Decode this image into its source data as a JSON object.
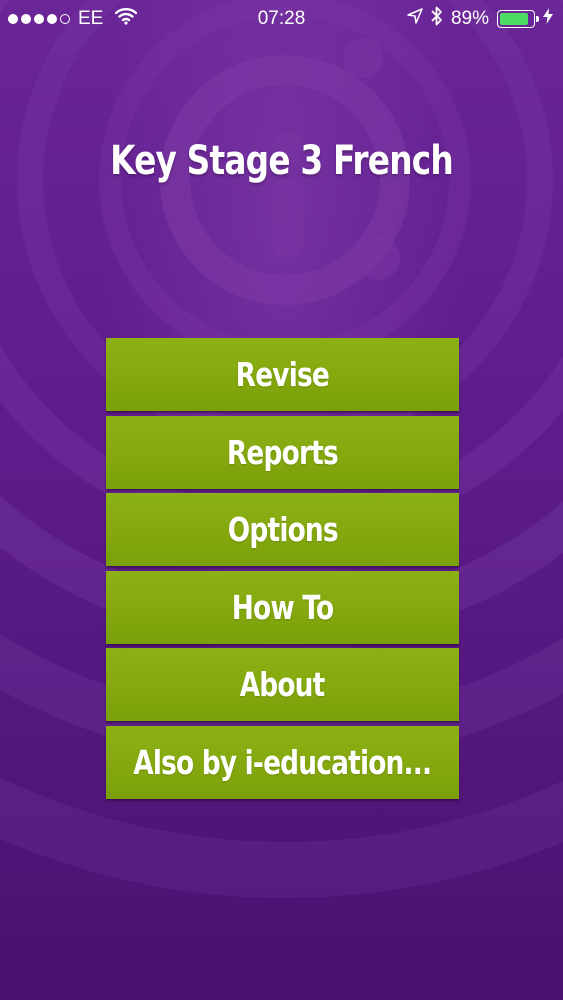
{
  "status_bar": {
    "carrier": "EE",
    "time": "07:28",
    "battery_percent": "89%",
    "battery_level": 0.89,
    "battery_color": "#4cd964",
    "icons": [
      "signal-dots-icon",
      "wifi-icon",
      "location-arrow-icon",
      "bluetooth-icon",
      "battery-icon",
      "charging-bolt-icon"
    ]
  },
  "app": {
    "title": "Key Stage 3 French",
    "logo_icon": "i-education-logo-icon"
  },
  "menu": {
    "items": [
      {
        "label": "Revise"
      },
      {
        "label": "Reports"
      },
      {
        "label": "Options"
      },
      {
        "label": "How To"
      },
      {
        "label": "About"
      },
      {
        "label": "Also by i-education..."
      }
    ]
  },
  "theme": {
    "background": "#5e1d8c",
    "button_green": "#84a80e",
    "text": "#ffffff"
  }
}
